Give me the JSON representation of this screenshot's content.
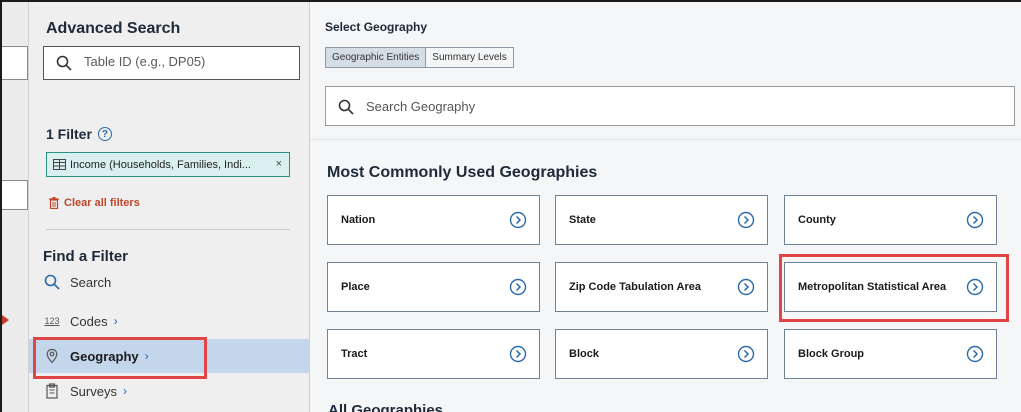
{
  "sidebar": {
    "title": "Advanced Search",
    "search_placeholder": "Table ID (e.g., DP05)",
    "filter_count_label": "1 Filter",
    "help_symbol": "?",
    "active_filter": "Income (Households, Families, Indi...",
    "chip_close": "×",
    "clear_filters": "Clear all filters",
    "find_filter_title": "Find a Filter",
    "nav": {
      "search": "Search",
      "codes": "Codes",
      "codes_icon_text": "123",
      "geography": "Geography",
      "surveys": "Surveys",
      "chevron": "›"
    }
  },
  "main": {
    "select_title": "Select Geography",
    "tabs": [
      "Geographic Entities",
      "Summary Levels"
    ],
    "search_placeholder": "Search Geography",
    "common_title": "Most Commonly Used Geographies",
    "geographies": [
      "Nation",
      "State",
      "County",
      "Place",
      "Zip Code Tabulation Area",
      "Metropolitan Statistical Area",
      "Tract",
      "Block",
      "Block Group"
    ],
    "all_title": "All Geographies"
  },
  "colors": {
    "highlight": "#e04545",
    "accent": "#2a6aa8",
    "chip_bg": "#d9f0ef",
    "active_nav": "#c4d6ec"
  },
  "icons": [
    "search-icon",
    "help-icon",
    "table-icon",
    "trash-icon",
    "map-pin-icon",
    "codes-icon",
    "clipboard-icon",
    "chevron-right-circle-icon"
  ]
}
